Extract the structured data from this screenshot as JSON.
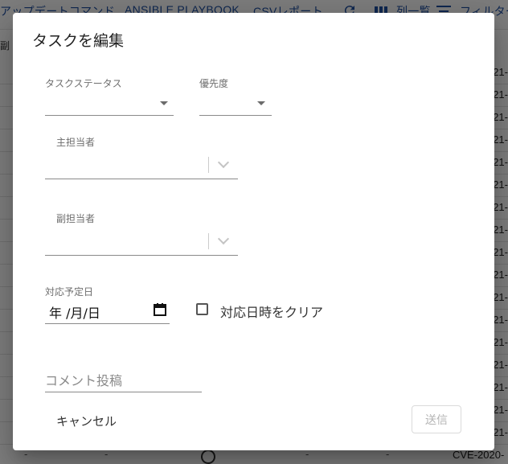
{
  "background": {
    "toolbar": {
      "update_command": "アップデートコマンド",
      "ansible_playbook": "ANSIBLE PLAYBOOK",
      "csv_report": "CSVレポート",
      "columns": "列一覧",
      "filter": "フィルター"
    },
    "column_header_partial": "副",
    "row_cell_partial": "21-",
    "bottom_row": {
      "dash": "-",
      "cve_partial": "CVE-2020-"
    }
  },
  "dialog": {
    "title": "タスクを編集",
    "task_status": {
      "label": "タスクステータス",
      "value": ""
    },
    "priority": {
      "label": "優先度",
      "value": ""
    },
    "main_assignee": {
      "label": "主担当者",
      "value": ""
    },
    "sub_assignee": {
      "label": "副担当者",
      "value": ""
    },
    "due_date": {
      "label": "対応予定日",
      "value": "年 /月/日"
    },
    "clear_checkbox": {
      "label": "対応日時をクリア",
      "checked": false
    },
    "comment": {
      "placeholder": "コメント投稿",
      "value": ""
    },
    "cancel_button": "キャンセル",
    "submit_button": "送信"
  },
  "icons": [
    "refresh-icon",
    "columns-icon",
    "filter-icon",
    "dropdown-arrow-icon",
    "chevron-down-icon",
    "calendar-icon",
    "checkbox-icon"
  ]
}
